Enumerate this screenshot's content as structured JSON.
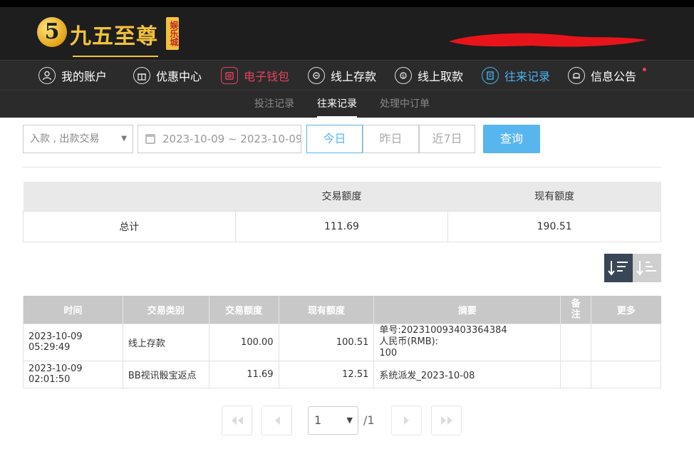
{
  "brand": {
    "mark": "5",
    "name": "九五至尊",
    "tag": "娱乐城"
  },
  "nav": [
    {
      "label": "我的账户",
      "icon": "user-icon"
    },
    {
      "label": "优惠中心",
      "icon": "gift-icon"
    },
    {
      "label": "电子钱包",
      "icon": "wallet-icon"
    },
    {
      "label": "线上存款",
      "icon": "deposit-icon"
    },
    {
      "label": "线上取款",
      "icon": "withdraw-icon"
    },
    {
      "label": "往来记录",
      "icon": "records-icon"
    },
    {
      "label": "信息公告",
      "icon": "bell-icon"
    }
  ],
  "subnav": [
    {
      "label": "投注记录"
    },
    {
      "label": "往来记录"
    },
    {
      "label": "处理中订单"
    }
  ],
  "filters": {
    "type_value": "入款 , 出款交易",
    "date_range": "2023-10-09 ~ 2023-10-09",
    "quick": [
      "今日",
      "昨日",
      "近7日"
    ],
    "search_label": "查询"
  },
  "summary": {
    "headers": [
      "",
      "交易额度",
      "现有额度"
    ],
    "row": [
      "总计",
      "111.69",
      "190.51"
    ]
  },
  "records": {
    "headers": [
      "时间",
      "交易类别",
      "交易额度",
      "现有额度",
      "摘要",
      "备注",
      "更多"
    ],
    "rows": [
      {
        "time": "2023-10-09 05:29:49",
        "category": "线上存款",
        "amount": "100.00",
        "balance": "100.51",
        "summary_1": "单号:202310093403364384",
        "summary_2": "人民币(RMB):",
        "summary_3": "100",
        "remark": "",
        "more": ""
      },
      {
        "time": "2023-10-09 02:01:50",
        "category": "BB视讯骰宝返点",
        "amount": "11.69",
        "balance": "12.51",
        "summary_1": "系统派发_2023-10-08",
        "remark": "",
        "more": ""
      }
    ]
  },
  "pagination": {
    "current": "1",
    "total": "/1"
  },
  "colors": {
    "accent": "#58b6ef",
    "active_red": "#e3425e",
    "active_blue": "#4ab2f0",
    "header_bg": "#1e1e1e",
    "brand_gold": "#f3c23a"
  }
}
